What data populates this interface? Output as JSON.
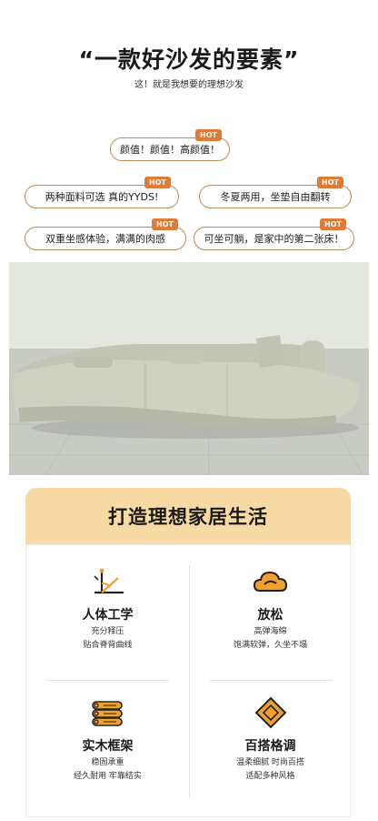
{
  "header": {
    "title": "“一款好沙发的要素”",
    "subtitle": "这！就是我想要的理想沙发"
  },
  "badge_label": "HOT",
  "features": [
    "颜值！颜值！高颜值！",
    "两种面料可选 真的YYDS!",
    "冬夏两用，坐垫自由翻转",
    "双重坐感体验，满满的肉感",
    "可坐可躺，是家中的第二张床！"
  ],
  "section": {
    "banner": "打造理想家居生活",
    "cards": [
      {
        "icon": "ergonomics-icon",
        "title": "人体工学",
        "lines": [
          "充分释压",
          "贴合脊背曲线"
        ]
      },
      {
        "icon": "cloud-icon",
        "title": "放松",
        "lines": [
          "高弹海绵",
          "饱满软弹，久坐不塌"
        ]
      },
      {
        "icon": "wood-frame-icon",
        "title": "实木框架",
        "lines": [
          "稳固承重",
          "经久耐用 牢靠结实"
        ]
      },
      {
        "icon": "diamond-icon",
        "title": "百搭格调",
        "lines": [
          "温柔细腻 时尚百搭",
          "适配多种风格"
        ]
      }
    ]
  },
  "colors": {
    "accent": "#e07a35",
    "pill_border": "#b98d5a",
    "banner_bg": "#f7d9a4",
    "icon_orange": "#f0a030"
  }
}
